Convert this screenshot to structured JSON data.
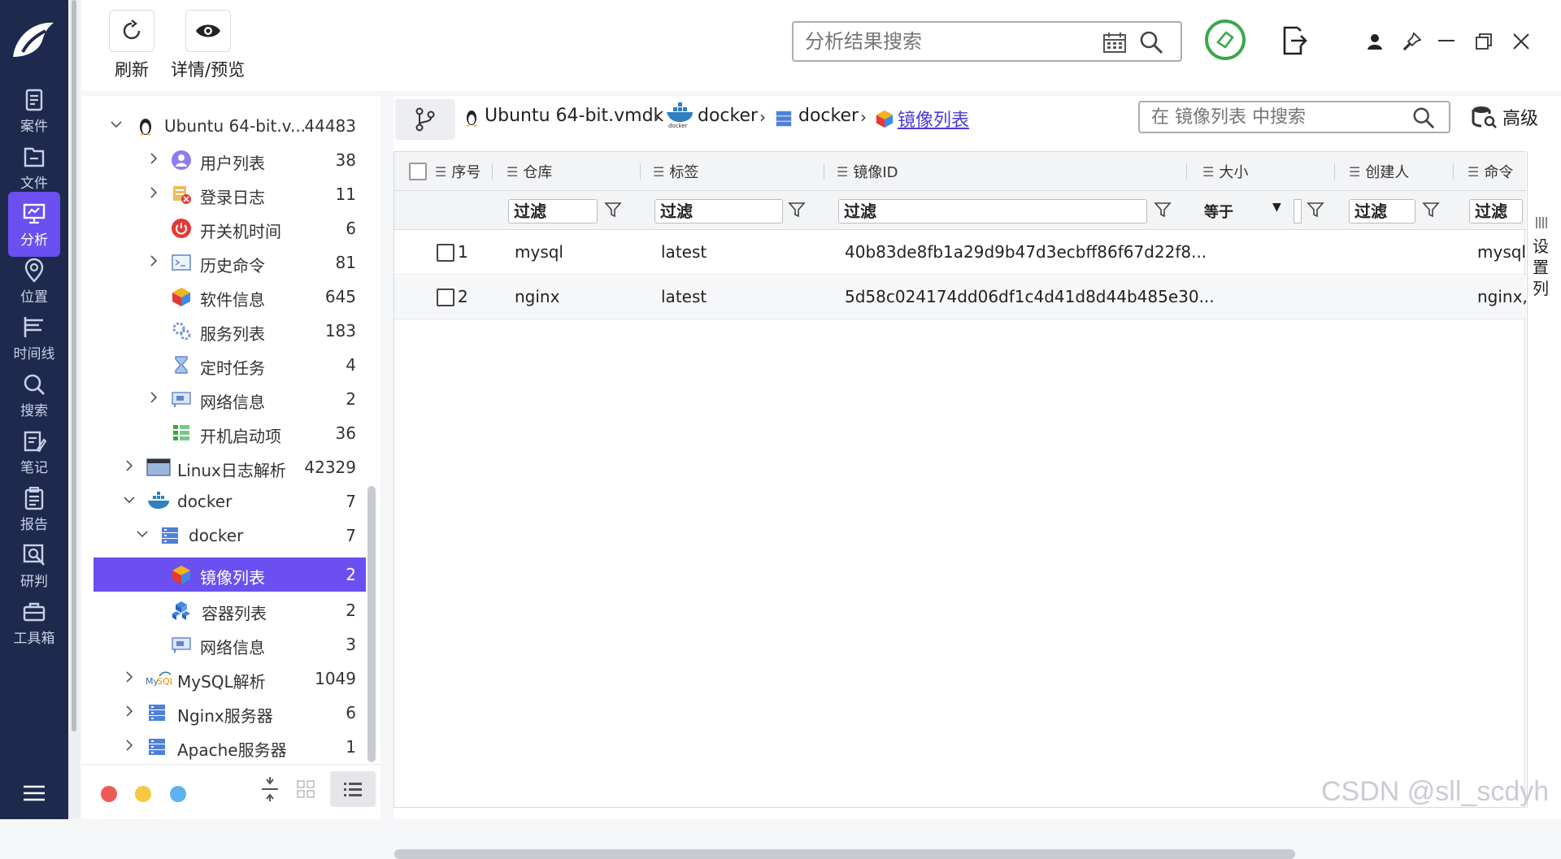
{
  "nav": {
    "items": [
      {
        "label": "案件",
        "icon": "case-icon"
      },
      {
        "label": "文件",
        "icon": "folder-icon"
      },
      {
        "label": "分析",
        "icon": "analysis-icon"
      },
      {
        "label": "位置",
        "icon": "location-icon"
      },
      {
        "label": "时间线",
        "icon": "timeline-icon"
      },
      {
        "label": "搜索",
        "icon": "search-icon"
      },
      {
        "label": "笔记",
        "icon": "note-icon"
      },
      {
        "label": "报告",
        "icon": "report-icon"
      },
      {
        "label": "研判",
        "icon": "judge-icon"
      },
      {
        "label": "工具箱",
        "icon": "toolbox-icon"
      }
    ],
    "active_index": 2
  },
  "toolbar": {
    "refresh_label": "刷新",
    "preview_label": "详情/预览",
    "search_placeholder": "分析结果搜索"
  },
  "tree": {
    "root": {
      "label": "Ubuntu 64-bit.v...",
      "count": "44483"
    },
    "items": [
      {
        "label": "用户列表",
        "count": "38"
      },
      {
        "label": "登录日志",
        "count": "11"
      },
      {
        "label": "开关机时间",
        "count": "6"
      },
      {
        "label": "历史命令",
        "count": "81"
      },
      {
        "label": "软件信息",
        "count": "645"
      },
      {
        "label": "服务列表",
        "count": "183"
      },
      {
        "label": "定时任务",
        "count": "4"
      },
      {
        "label": "网络信息",
        "count": "2"
      },
      {
        "label": "开机启动项",
        "count": "36"
      },
      {
        "label": "Linux日志解析",
        "count": "42329"
      },
      {
        "label": "docker",
        "count": "7"
      },
      {
        "label": "docker",
        "count": "7"
      },
      {
        "label": "镜像列表",
        "count": "2"
      },
      {
        "label": "容器列表",
        "count": "2"
      },
      {
        "label": "网络信息",
        "count": "3"
      },
      {
        "label": "MySQL解析",
        "count": "1049"
      },
      {
        "label": "Nginx服务器",
        "count": "6"
      },
      {
        "label": "Apache服务器",
        "count": "1"
      }
    ]
  },
  "breadcrumb": {
    "items": [
      "Ubuntu 64-bit.vmdk",
      "docker",
      "docker",
      "镜像列表"
    ],
    "docker_logo_text": "docker"
  },
  "table_search": {
    "placeholder": "在 镜像列表 中搜索"
  },
  "advanced_label": "高级",
  "table": {
    "columns": [
      "序号",
      "仓库",
      "标签",
      "镜像ID",
      "大小",
      "创建人",
      "命令"
    ],
    "filter_placeholder": "过滤",
    "size_operator": "等于",
    "rows": [
      {
        "index": "1",
        "repo": "mysql",
        "tag": "latest",
        "image_id": "40b83de8fb1a29d9b47d3ecbff86f67d22f8...",
        "command": "mysql("
      },
      {
        "index": "2",
        "repo": "nginx",
        "tag": "latest",
        "image_id": "5d58c024174dd06df1c4d41d8d44b485e30...",
        "command": "nginx,-"
      }
    ]
  },
  "settings_column_label": "设置列",
  "watermark": "CSDN @sll_scdyh",
  "colors": {
    "nav_bg": "#1d2a4d",
    "accent": "#6b4ff0",
    "status_green": "#3aa84a"
  }
}
